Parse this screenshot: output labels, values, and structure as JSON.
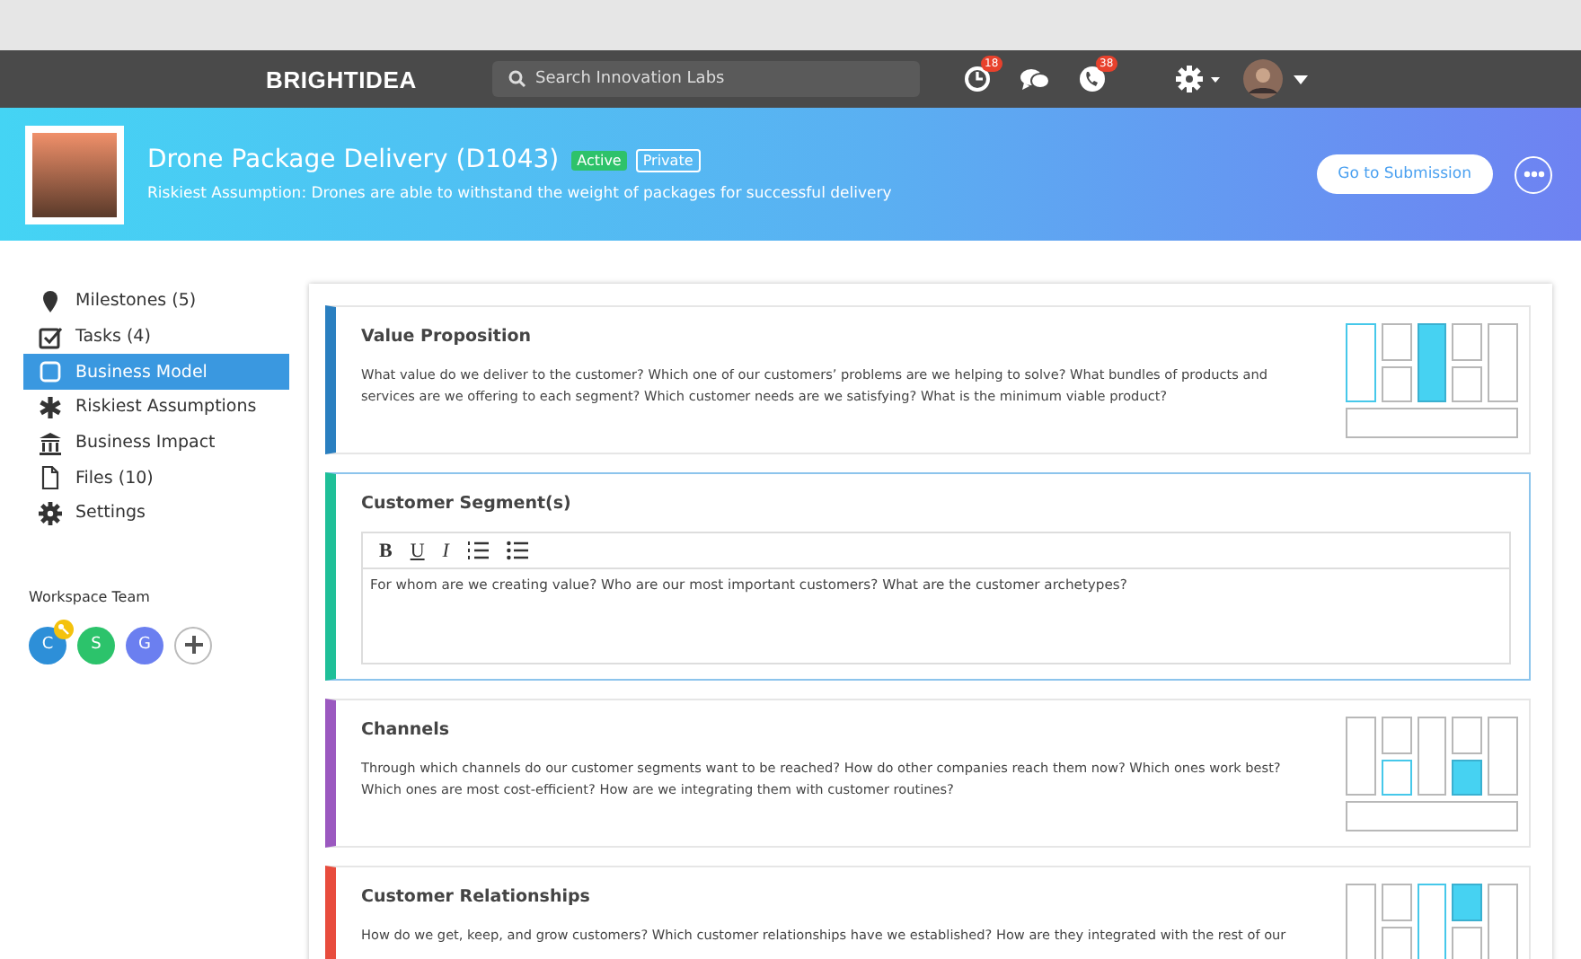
{
  "nav": {
    "logo": "BRIGHTIDEA",
    "search": {
      "placeholder": "Search Innovation Labs"
    },
    "notifications": [
      {
        "kind": "timer",
        "badge": "18"
      },
      {
        "kind": "chat"
      },
      {
        "kind": "phone",
        "badge": "38"
      }
    ]
  },
  "header": {
    "title": "Drone Package Delivery (D1043)",
    "tags": [
      {
        "label": "Active",
        "kind": "status"
      },
      {
        "label": "Private",
        "kind": "outline"
      }
    ],
    "subtitle": "Riskiest Assumption: Drones are able to withstand the weight of packages for successful delivery",
    "button": "Go to Submission"
  },
  "sidebar": {
    "items": [
      {
        "label": "Milestones (5)",
        "selected": false
      },
      {
        "label": "Tasks (4)",
        "selected": false
      },
      {
        "label": "Business Model",
        "selected": true
      },
      {
        "label": "Riskiest Assumptions",
        "selected": false
      },
      {
        "label": "Business Impact",
        "selected": false
      },
      {
        "label": "Files (10)",
        "selected": false
      },
      {
        "label": "Settings",
        "selected": false
      }
    ],
    "team_title": "Workspace Team",
    "team": [
      {
        "initial": "C",
        "color": "#2d8fd8",
        "owner": true
      },
      {
        "initial": "S",
        "color": "#2cc36b",
        "owner": false
      },
      {
        "initial": "G",
        "color": "#6b7ff0",
        "owner": false
      }
    ]
  },
  "cards": [
    {
      "kind": "canvas",
      "title": "Value Proposition",
      "color": "#2a7fc0",
      "selected": false,
      "text": "What value do we deliver to the customer? Which one of our customers’ problems are we helping to solve? What bundles of products and services are we offering to each segment? Which customer needs are we satisfying? What is the minimum viable product?",
      "cells": [
        {
          "filled": false,
          "outlined": true
        },
        {
          "filled": false,
          "outlined": false
        },
        {
          "filled": false,
          "outlined": false
        },
        {
          "filled": true,
          "outlined": false
        },
        {
          "filled": false,
          "outlined": false
        },
        {
          "filled": false,
          "outlined": false
        },
        {
          "filled": false,
          "outlined": false
        },
        {
          "filled": false,
          "outlined": false
        }
      ]
    },
    {
      "kind": "editor",
      "title": "Customer Segment(s)",
      "color": "#1fbf98",
      "selected": true,
      "toolbar": [
        "B",
        "U",
        "I"
      ],
      "text": "For whom are we creating value? Who are our most important customers? What are the customer archetypes?"
    },
    {
      "kind": "canvas",
      "title": "Channels",
      "color": "#9b59c0",
      "selected": false,
      "text": "Through which channels do our customer segments want to be reached? How do other companies reach them now? Which ones work best? Which ones are most cost-efficient? How are we integrating them with customer routines?",
      "cells": [
        {
          "filled": false,
          "outlined": false
        },
        {
          "filled": false,
          "outlined": false
        },
        {
          "filled": false,
          "outlined": true
        },
        {
          "filled": false,
          "outlined": false
        },
        {
          "filled": false,
          "outlined": false
        },
        {
          "filled": true,
          "outlined": false
        },
        {
          "filled": false,
          "outlined": false
        },
        {
          "filled": false,
          "outlined": false
        }
      ]
    },
    {
      "kind": "canvas",
      "title": "Customer Relationships",
      "color": "#e84c3d",
      "selected": false,
      "text": "How do we get, keep, and grow customers? Which customer relationships have we established? How are they integrated with the rest of our",
      "cells": [
        {
          "filled": false,
          "outlined": false
        },
        {
          "filled": false,
          "outlined": false
        },
        {
          "filled": false,
          "outlined": false
        },
        {
          "filled": false,
          "outlined": true
        },
        {
          "filled": true,
          "outlined": false
        },
        {
          "filled": false,
          "outlined": false
        },
        {
          "filled": false,
          "outlined": false
        }
      ]
    }
  ]
}
